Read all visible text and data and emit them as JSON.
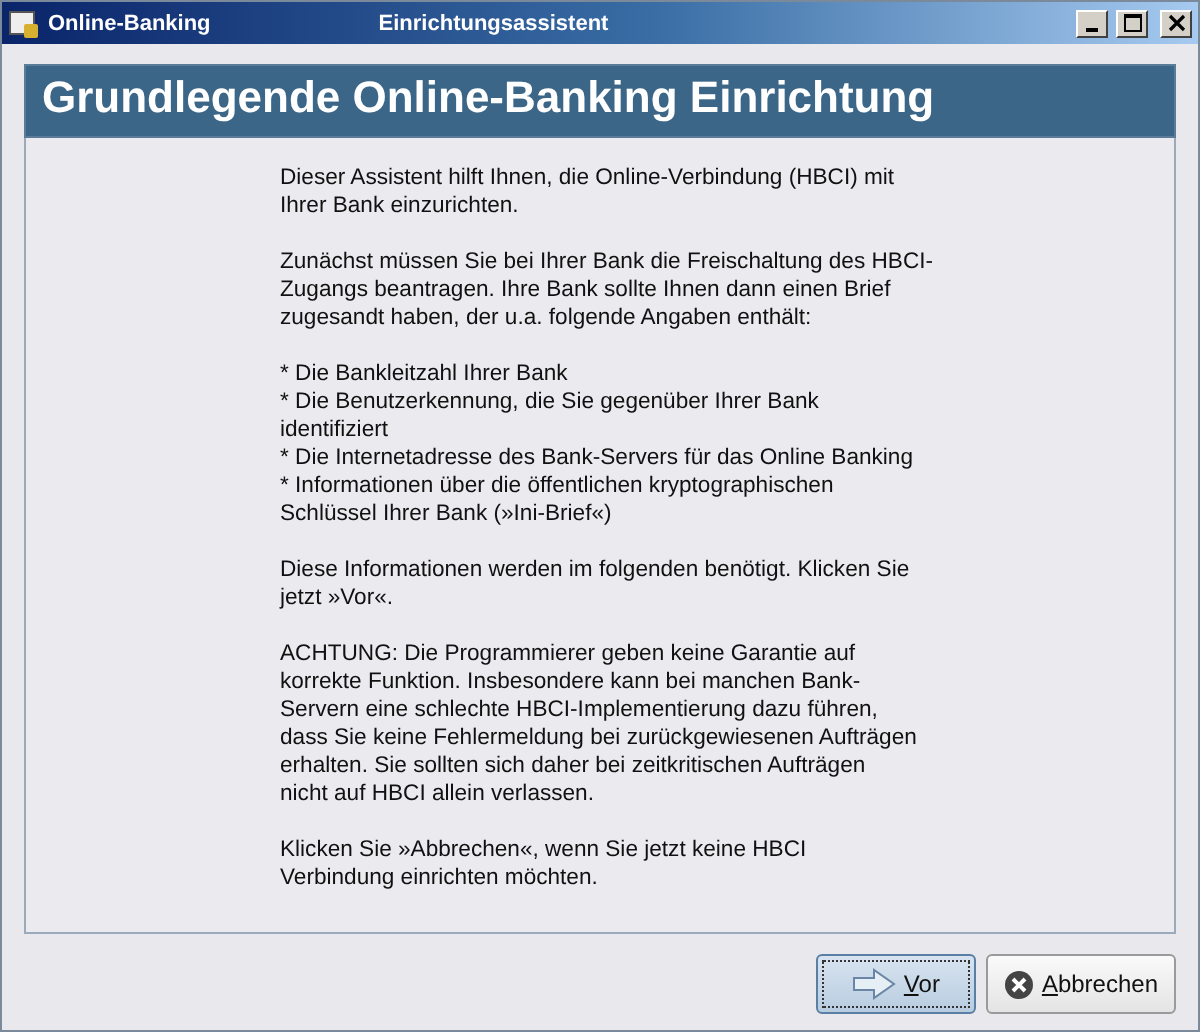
{
  "window": {
    "app": "Online-Banking",
    "title": "Einrichtungsassistent"
  },
  "header": {
    "title": "Grundlegende Online-Banking Einrichtung"
  },
  "paragraphs": [
    {
      "lines": [
        "Dieser Assistent hilft Ihnen, die Online-Verbindung (HBCI) mit",
        "Ihrer Bank einzurichten."
      ]
    },
    {
      "lines": [
        "Zunächst müssen Sie bei Ihrer Bank die Freischaltung des HBCI-",
        "Zugangs beantragen. Ihre Bank sollte Ihnen dann einen Brief",
        "zugesandt haben, der u.a. folgende Angaben enthält:"
      ]
    },
    {
      "lines": [
        "* Die Bankleitzahl Ihrer Bank",
        "* Die Benutzerkennung, die Sie gegenüber Ihrer Bank",
        "identifiziert",
        "* Die Internetadresse des Bank-Servers für das Online Banking",
        "* Informationen über die öffentlichen kryptographischen",
        "Schlüssel Ihrer Bank (»Ini-Brief«)"
      ]
    },
    {
      "lines": [
        "Diese Informationen werden im folgenden benötigt. Klicken Sie",
        "jetzt »Vor«."
      ]
    },
    {
      "lines": [
        "ACHTUNG: Die Programmierer geben keine Garantie auf",
        "korrekte Funktion. Insbesondere kann bei manchen Bank-",
        "Servern eine schlechte HBCI-Implementierung dazu führen,",
        "dass Sie keine Fehlermeldung bei zurückgewiesenen Aufträgen",
        "erhalten. Sie sollten sich daher bei zeitkritischen Aufträgen",
        "nicht auf HBCI allein verlassen."
      ]
    },
    {
      "lines": [
        "Klicken Sie »Abbrechen«, wenn Sie jetzt keine HBCI",
        "Verbindung einrichten möchten."
      ]
    }
  ],
  "buttons": [
    {
      "label": "Vor",
      "kind": "next",
      "default": true
    },
    {
      "label": "Abbrechen",
      "kind": "cancel",
      "default": false
    }
  ]
}
